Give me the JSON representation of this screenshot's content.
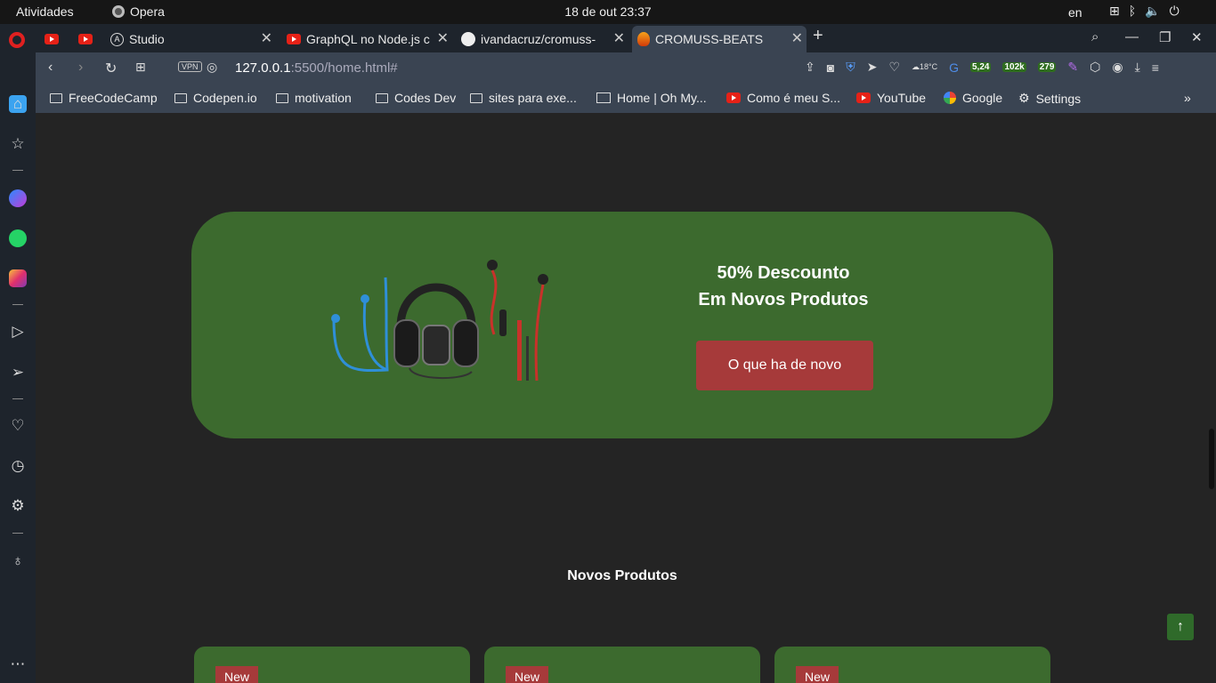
{
  "system_bar": {
    "activities": "Atividades",
    "app_name": "Opera",
    "datetime": "18 de out  23:37",
    "language": "en"
  },
  "tabs": [
    {
      "label": "",
      "icon": "youtube-icon"
    },
    {
      "label": "",
      "icon": "youtube-icon"
    },
    {
      "label": "Studio",
      "icon": "apollo-icon"
    },
    {
      "label": "GraphQL no Node.js c",
      "icon": "youtube-icon"
    },
    {
      "label": "ivandacruz/cromuss-",
      "icon": "github-icon"
    },
    {
      "label": "CROMUSS-BEATS",
      "icon": "fire-icon",
      "active": true
    }
  ],
  "address_bar": {
    "vpn": "VPN",
    "url_host": "127.0.0.1",
    "url_path": ":5500/home.html#"
  },
  "toolbar_badges": {
    "weather": "18°C",
    "crypto": "5,24",
    "count1": "102k",
    "count2": "279"
  },
  "bookmarks": [
    {
      "label": "FreeCodeCamp",
      "icon": "folder-icon"
    },
    {
      "label": "Codepen.io",
      "icon": "folder-icon"
    },
    {
      "label": "motivation",
      "icon": "folder-icon"
    },
    {
      "label": "Codes Dev",
      "icon": "folder-icon"
    },
    {
      "label": "sites para exe...",
      "icon": "folder-icon"
    },
    {
      "label": "Home | Oh My...",
      "icon": "terminal-icon"
    },
    {
      "label": "Como é meu S...",
      "icon": "youtube-icon"
    },
    {
      "label": "YouTube",
      "icon": "youtube-icon"
    },
    {
      "label": "Google",
      "icon": "google-icon"
    },
    {
      "label": "Settings",
      "icon": "gear-icon"
    }
  ],
  "page": {
    "promo_line1": "50% Descounto",
    "promo_line2": "Em Novos Produtos",
    "promo_button": "O que ha de novo",
    "section_title": "Novos Produtos",
    "cards": [
      {
        "tag": "New"
      },
      {
        "tag": "New"
      },
      {
        "tag": "New"
      }
    ]
  },
  "colors": {
    "banner_bg": "#3c6a2e",
    "button_bg": "#a63a3a",
    "page_bg": "#242424"
  }
}
